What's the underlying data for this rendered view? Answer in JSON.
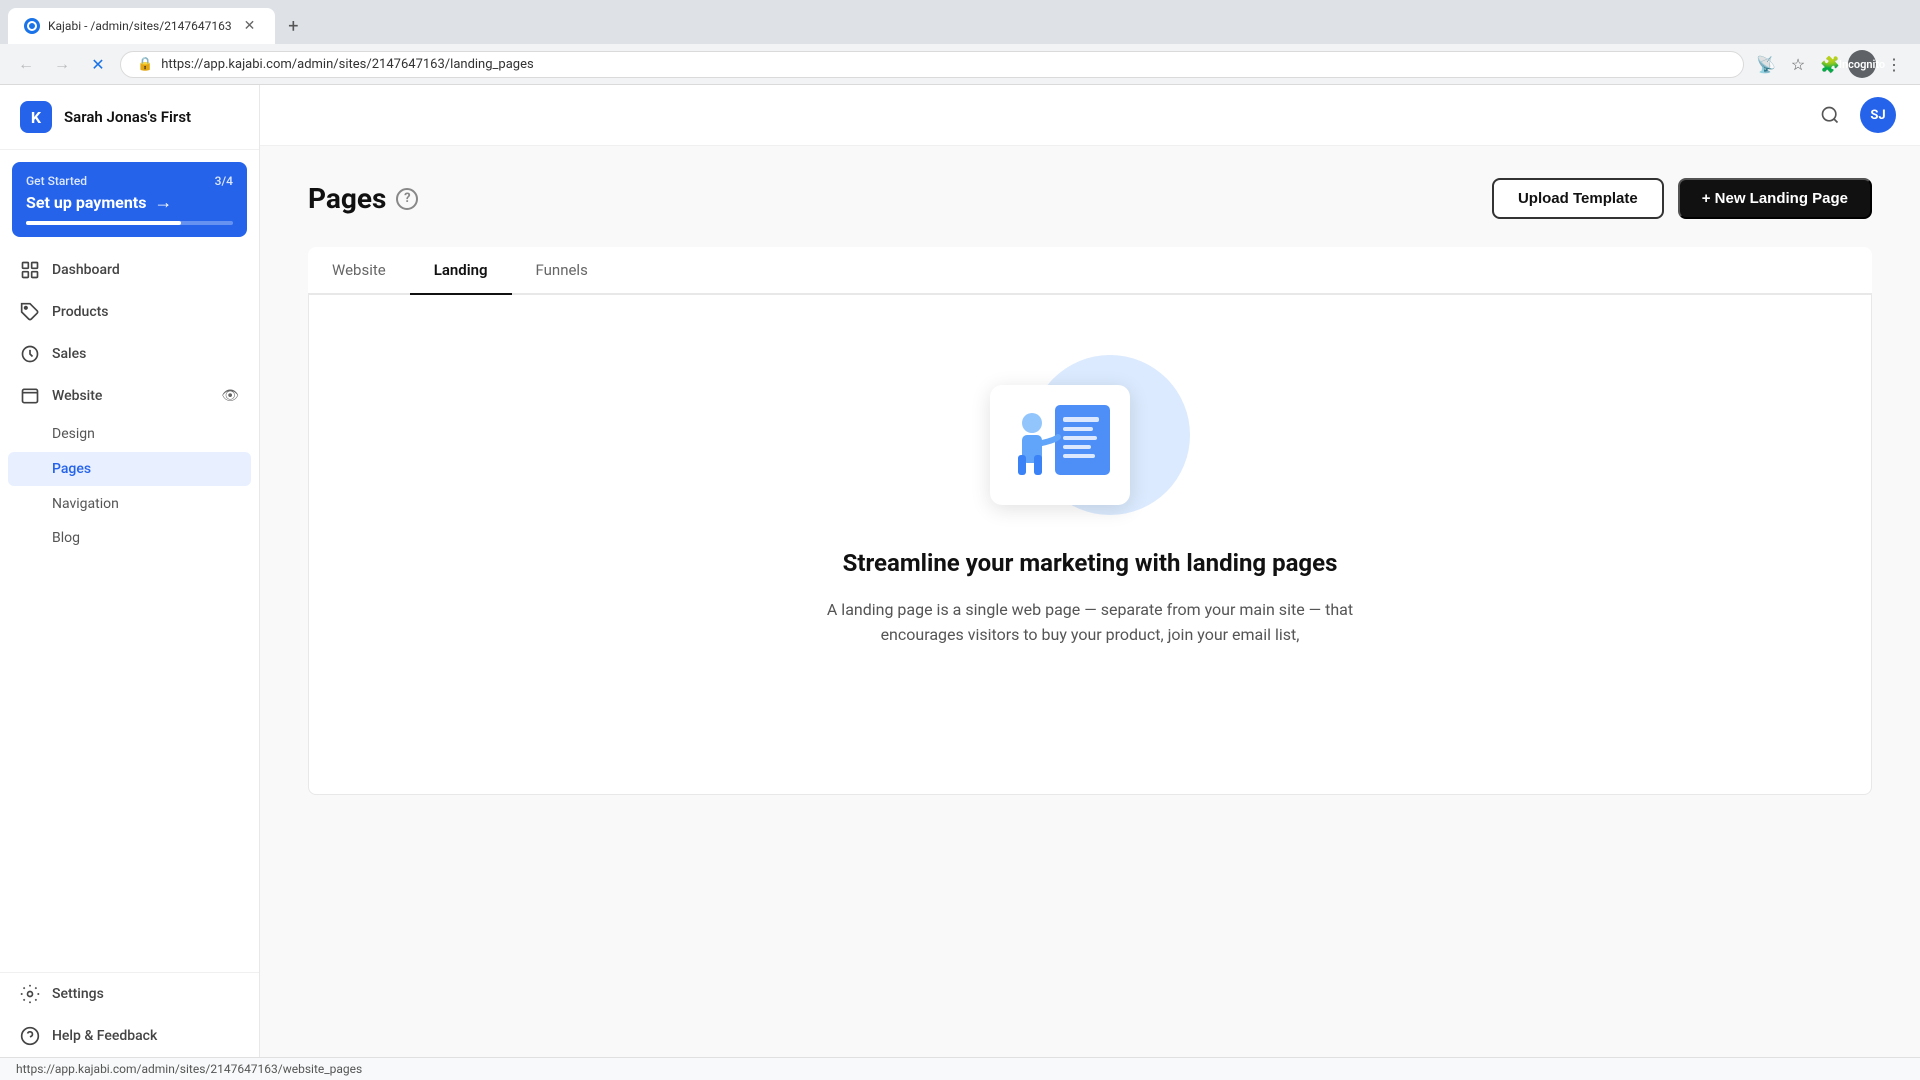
{
  "browser": {
    "tab_title": "Kajabi - /admin/sites/2147647163",
    "tab_favicon": "K",
    "url": "app.kajabi.com/admin/sites/2147647163/landing_pages",
    "url_full": "https://app.kajabi.com/admin/sites/2147647163/landing_pages",
    "profile_label": "Incognito"
  },
  "sidebar": {
    "app_logo": "K",
    "app_name": "Sarah Jonas's First",
    "get_started": {
      "label": "Get Started",
      "progress": "3/4",
      "action": "Set up payments",
      "arrow": "→"
    },
    "nav_items": [
      {
        "id": "dashboard",
        "label": "Dashboard"
      },
      {
        "id": "products",
        "label": "Products"
      },
      {
        "id": "sales",
        "label": "Sales"
      },
      {
        "id": "website",
        "label": "Website"
      }
    ],
    "website_sub_items": [
      {
        "id": "design",
        "label": "Design"
      },
      {
        "id": "pages",
        "label": "Pages",
        "active": true
      },
      {
        "id": "navigation",
        "label": "Navigation"
      },
      {
        "id": "blog",
        "label": "Blog"
      }
    ],
    "bottom_items": [
      {
        "id": "settings",
        "label": "Settings"
      },
      {
        "id": "help",
        "label": "Help & Feedback"
      }
    ]
  },
  "topbar": {
    "user_initials": "SJ"
  },
  "page": {
    "title": "Pages",
    "tabs": [
      {
        "id": "website",
        "label": "Website"
      },
      {
        "id": "landing",
        "label": "Landing",
        "active": true
      },
      {
        "id": "funnels",
        "label": "Funnels"
      }
    ],
    "actions": {
      "upload_template": "Upload Template",
      "new_landing_page": "+ New Landing Page"
    }
  },
  "empty_state": {
    "title": "Streamline your marketing with landing pages",
    "description": "A landing page is a single web page — separate from your main site — that encourages visitors to buy your product, join your email list,"
  },
  "status_bar": {
    "url": "https://app.kajabi.com/admin/sites/2147647163/website_pages"
  }
}
